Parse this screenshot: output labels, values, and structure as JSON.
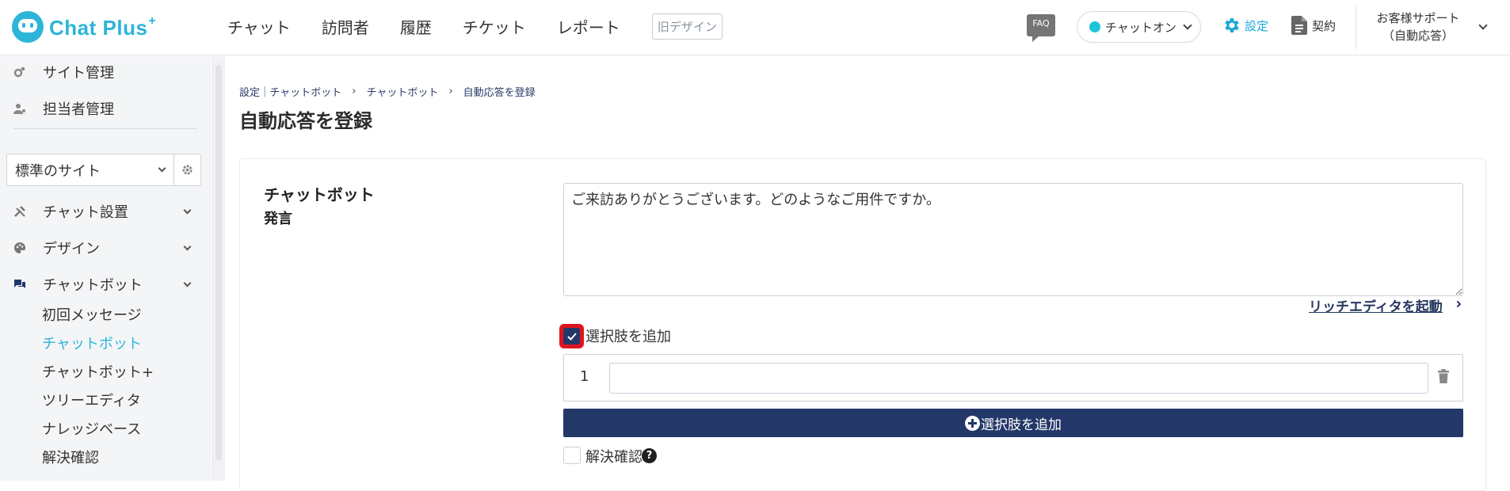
{
  "brand": {
    "name": "Chat Plus",
    "sup": "+"
  },
  "topnav": [
    "チャット",
    "訪問者",
    "履歴",
    "チケット",
    "レポート"
  ],
  "old_design": "旧デザイン",
  "faq": "FAQ",
  "chat_status": "チャットオン",
  "settings": "設定",
  "contract": "契約",
  "support": {
    "line1": "お客様サポート",
    "line2": "（自動応答）"
  },
  "sidebar": {
    "top_items": [
      "サイト管理",
      "担当者管理"
    ],
    "site_select": "標準のサイト",
    "sections": [
      "チャット設置",
      "デザイン",
      "チャットボット"
    ],
    "sub_items": [
      "初回メッセージ",
      "チャットボット",
      "チャットボット+",
      "ツリーエディタ",
      "ナレッジベース",
      "解決確認"
    ]
  },
  "breadcrumb": {
    "root": "設定",
    "parent": "チャットボット",
    "mid": "チャットボット",
    "current": "自動応答を登録"
  },
  "page_title": "自動応答を登録",
  "form": {
    "label": "チャットボット",
    "sublabel": "発言",
    "message": "ご来訪ありがとうございます。どのようなご用件ですか。",
    "rich_editor": "リッチエディタを起動",
    "add_choices_label": "選択肢を追加",
    "choice_number": "1",
    "choice_value": "",
    "add_choice_button": "選択肢を追加",
    "resolve_label": "解決確認",
    "help": "?"
  },
  "colors": {
    "brand": "#2cb5d8",
    "navy": "#233869",
    "highlight": "#e0141f"
  }
}
